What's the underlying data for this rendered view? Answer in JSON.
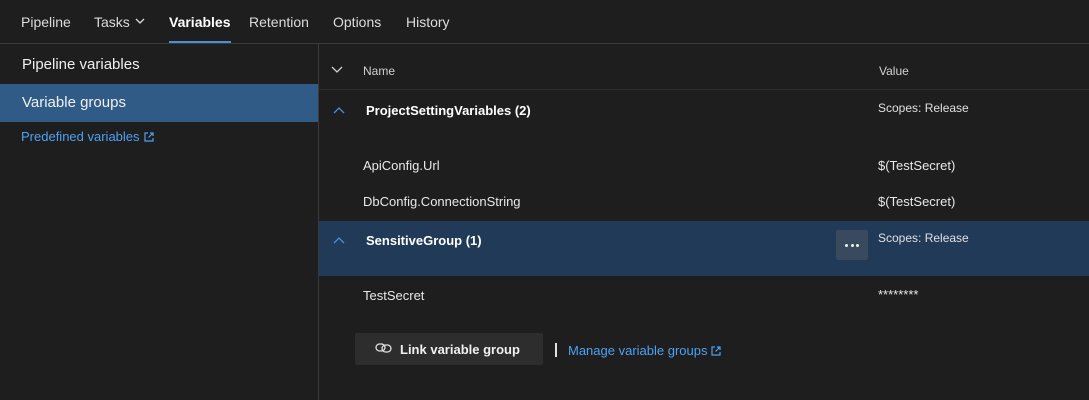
{
  "tabs": [
    {
      "label": "Pipeline"
    },
    {
      "label": "Tasks"
    },
    {
      "label": "Variables"
    },
    {
      "label": "Retention"
    },
    {
      "label": "Options"
    },
    {
      "label": "History"
    }
  ],
  "active_tab": "Variables",
  "sidebar": {
    "items": [
      {
        "label": "Pipeline variables"
      },
      {
        "label": "Variable groups"
      }
    ],
    "selected": "Variable groups",
    "link": "Predefined variables"
  },
  "table": {
    "columns": {
      "name": "Name",
      "value": "Value"
    },
    "groups": [
      {
        "title": "ProjectSettingVariables (2)",
        "scope": "Scopes: Release",
        "rows": [
          {
            "name": "ApiConfig.Url",
            "value": "$(TestSecret)"
          },
          {
            "name": "DbConfig.ConnectionString",
            "value": "$(TestSecret)"
          }
        ]
      },
      {
        "title": "SensitiveGroup (1)",
        "scope": "Scopes: Release",
        "rows": [
          {
            "name": "TestSecret",
            "value": "********"
          }
        ]
      }
    ]
  },
  "actions": {
    "link_button": "Link variable group",
    "manage_link": "Manage variable groups"
  },
  "colors": {
    "accent": "#4a8fd8",
    "selected_sidebar": "#2f5b86",
    "highlight_group": "#203a57",
    "link": "#4ea1f3"
  }
}
